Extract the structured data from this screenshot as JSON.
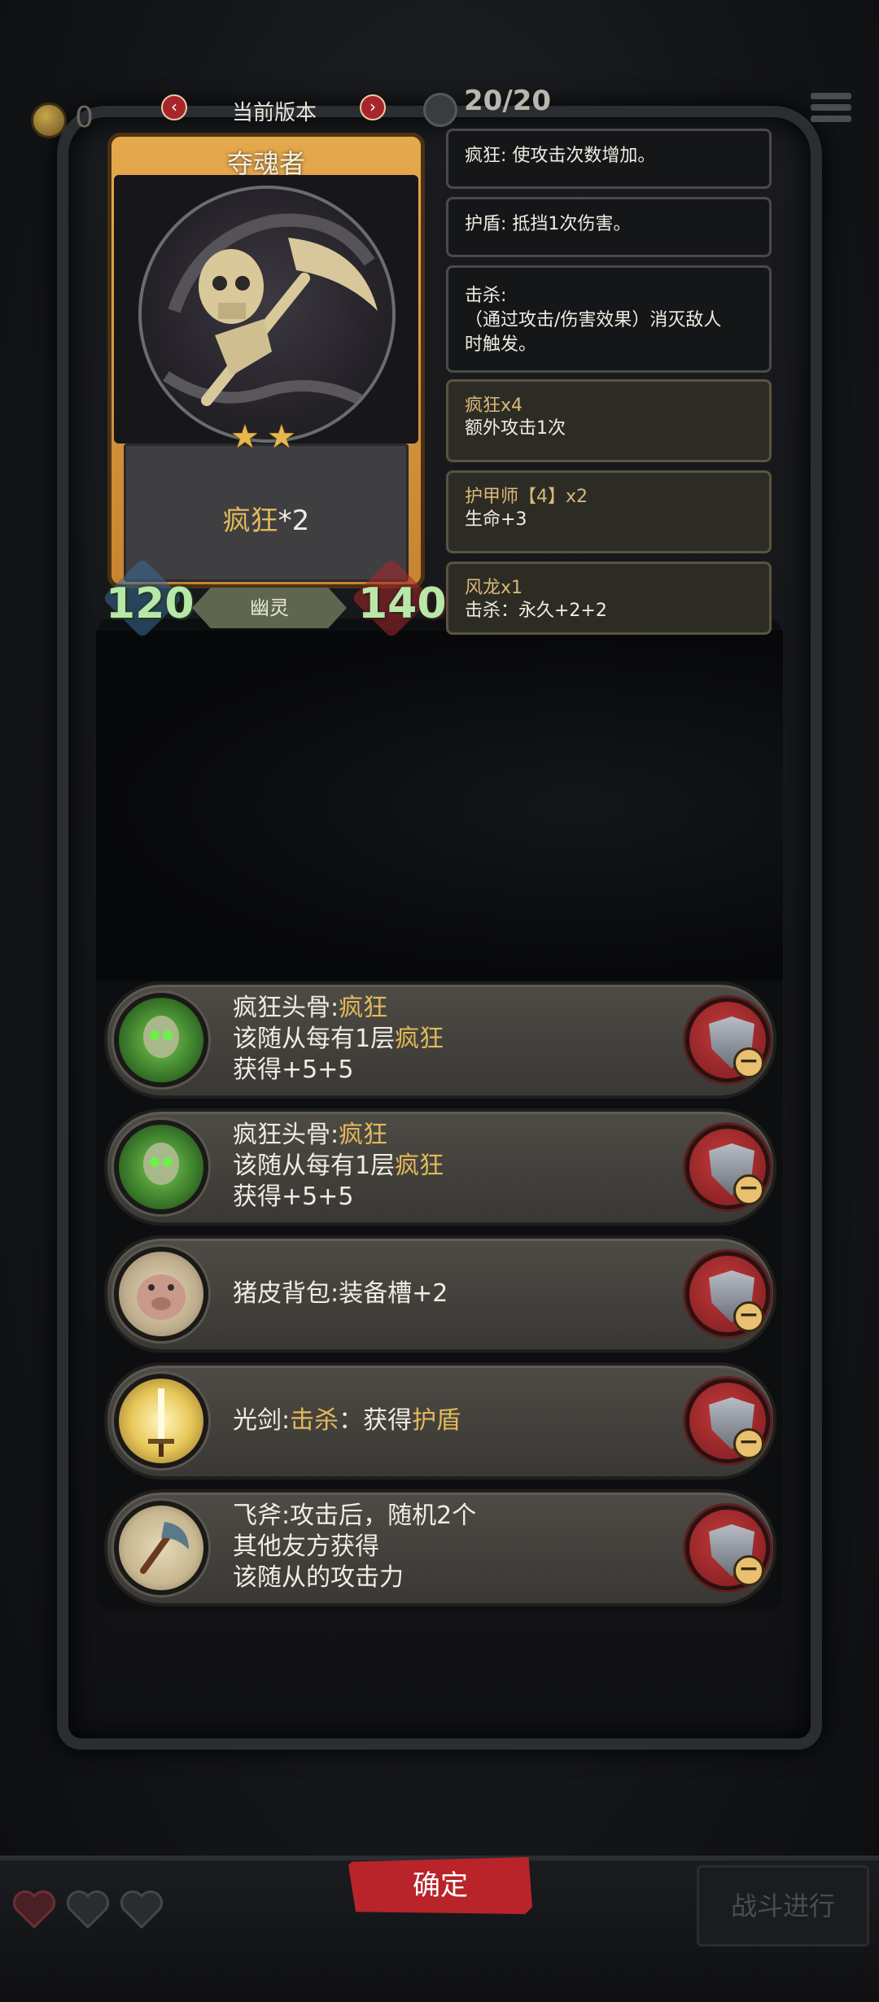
{
  "top_bar": {
    "coins": "0",
    "version_label": "当前版本",
    "prev_icon": "chevron-left-icon",
    "next_icon": "chevron-right-icon",
    "turn_counter": "20/20"
  },
  "card": {
    "name": "夺魂者",
    "stars": 2,
    "ability_name": "疯狂",
    "ability_mult": "*2",
    "attack": "120",
    "health": "140",
    "tribe": "幽灵",
    "colors": {
      "frame": "#e6a84c",
      "stat": "#b8e8a8"
    }
  },
  "tooltips": [
    {
      "lines": [
        "疯狂: 使攻击次数增加。"
      ]
    },
    {
      "lines": [
        "护盾: 抵挡1次伤害。"
      ]
    },
    {
      "lines": [
        "击杀:",
        "（通过攻击/伤害效果）消灭敌人",
        "时触发。"
      ]
    }
  ],
  "buffs": [
    {
      "title": "疯狂x4",
      "desc": "额外攻击1次"
    },
    {
      "title": "护甲师【4】x2",
      "desc": "生命+3"
    },
    {
      "title": "风龙x1",
      "desc": "击杀：永久+2+2"
    }
  ],
  "equipment": [
    {
      "name": "疯狂头骨",
      "sep": ":",
      "hl": "疯狂",
      "line2a": "该随从每有1层",
      "line2hl": "疯狂",
      "line3": "获得+5+5"
    },
    {
      "name": "疯狂头骨",
      "sep": ":",
      "hl": "疯狂",
      "line2a": "该随从每有1层",
      "line2hl": "疯狂",
      "line3": "获得+5+5"
    },
    {
      "text": "猪皮背包:装备槽+2"
    },
    {
      "pre": "光剑:",
      "hl1": "击杀",
      "mid": "：获得",
      "hl2": "护盾"
    },
    {
      "line1": "飞斧:攻击后，随机2个",
      "line2": "其他友方获得",
      "line3": "该随从的攻击力"
    }
  ],
  "bottom": {
    "confirm_label": "确定",
    "battle_label": "战斗进行",
    "lives": 3
  }
}
